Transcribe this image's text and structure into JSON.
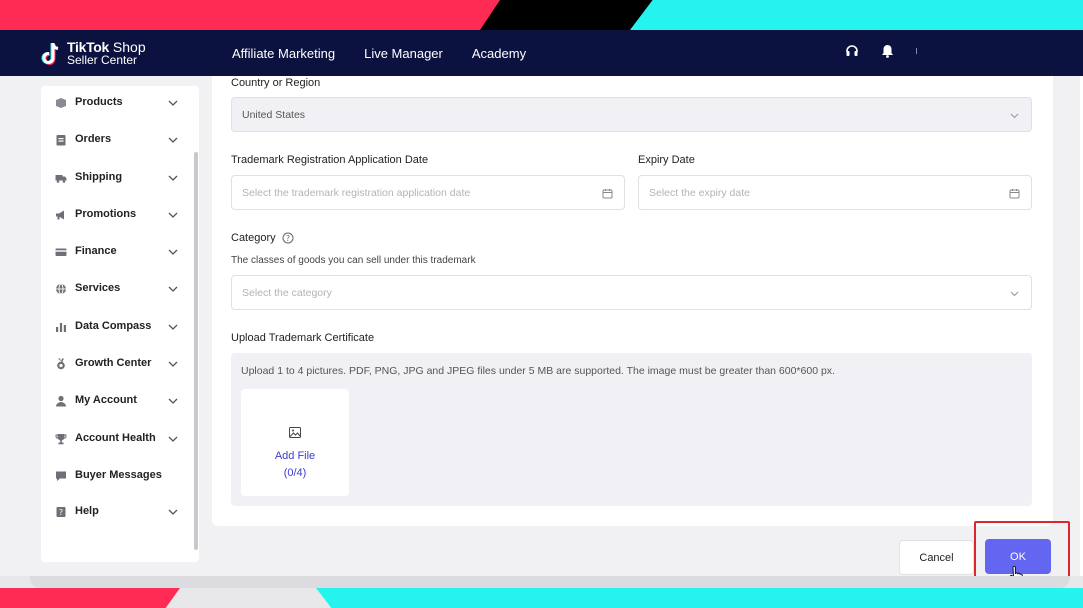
{
  "header": {
    "logo_brand": "TikTok",
    "logo_shop": "Shop",
    "logo_sub": "Seller Center",
    "nav": [
      "Affiliate Marketing",
      "Live Manager",
      "Academy"
    ],
    "icons": [
      "headset-icon",
      "bell-icon"
    ]
  },
  "sidebar": {
    "items": [
      {
        "label": "Products",
        "icon": "box-icon",
        "has_submenu": true
      },
      {
        "label": "Orders",
        "icon": "clipboard-icon",
        "has_submenu": true
      },
      {
        "label": "Shipping",
        "icon": "truck-icon",
        "has_submenu": true
      },
      {
        "label": "Promotions",
        "icon": "megaphone-icon",
        "has_submenu": true
      },
      {
        "label": "Finance",
        "icon": "card-icon",
        "has_submenu": true
      },
      {
        "label": "Services",
        "icon": "globe-icon",
        "has_submenu": true
      },
      {
        "label": "Data Compass",
        "icon": "bar-chart-icon",
        "has_submenu": true
      },
      {
        "label": "Growth Center",
        "icon": "medal-icon",
        "has_submenu": true
      },
      {
        "label": "My Account",
        "icon": "user-icon",
        "has_submenu": true
      },
      {
        "label": "Account Health",
        "icon": "trophy-icon",
        "has_submenu": true
      },
      {
        "label": "Buyer Messages",
        "icon": "chat-icon",
        "has_submenu": false
      },
      {
        "label": "Help",
        "icon": "help-book-icon",
        "has_submenu": true
      }
    ]
  },
  "form": {
    "country": {
      "label": "Country or Region",
      "value": "United States"
    },
    "reg_date": {
      "label": "Trademark Registration Application Date",
      "placeholder": "Select the trademark registration application date"
    },
    "expiry": {
      "label": "Expiry Date",
      "placeholder": "Select the expiry date"
    },
    "category": {
      "label": "Category",
      "hint": "The classes of goods you can sell under this trademark",
      "placeholder": "Select the category"
    },
    "upload": {
      "label": "Upload Trademark Certificate",
      "hint": "Upload 1 to 4 pictures. PDF, PNG, JPG and JPEG files under 5 MB are supported. The image must be greater than 600*600 px.",
      "add_label": "Add File",
      "count": "(0/4)"
    }
  },
  "footer": {
    "cancel": "Cancel",
    "ok": "OK"
  },
  "colors": {
    "primary": "#6366f1",
    "header_bg": "#0c1240",
    "highlight": "#e0242e",
    "tiktok_red": "#fe2c55",
    "tiktok_cyan": "#25f4ee"
  }
}
